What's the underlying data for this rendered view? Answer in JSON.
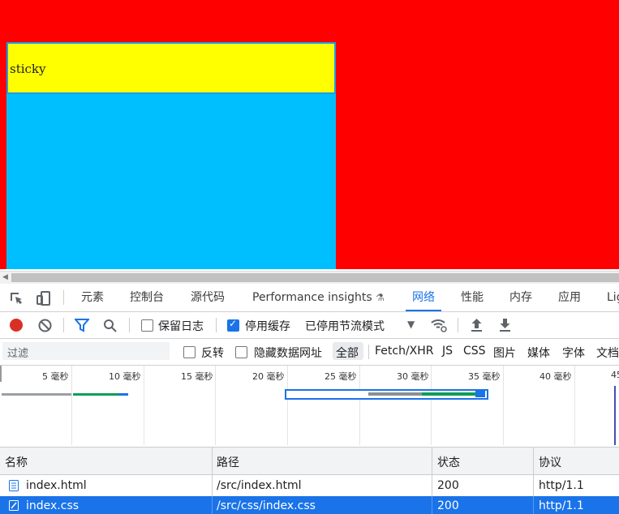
{
  "page": {
    "sticky_text": "sticky"
  },
  "devtools": {
    "tabs": [
      "元素",
      "控制台",
      "源代码",
      "Performance insights",
      "网络",
      "性能",
      "内存",
      "应用",
      "Lig"
    ],
    "active_tab": "网络",
    "toolbar": {
      "preserve_log": "保留日志",
      "preserve_log_checked": false,
      "disable_cache": "停用缓存",
      "disable_cache_checked": true,
      "throttle": "已停用节流模式"
    },
    "filter": {
      "placeholder": "过滤",
      "invert": "反转",
      "hide_data_urls": "隐藏数据网址",
      "types": [
        "全部",
        "Fetch/XHR",
        "JS",
        "CSS",
        "图片",
        "媒体",
        "字体",
        "文档"
      ],
      "active_type": "全部"
    },
    "timeline": {
      "ticks": [
        "5 毫秒",
        "10 毫秒",
        "15 毫秒",
        "20 毫秒",
        "25 毫秒",
        "30 毫秒",
        "35 毫秒",
        "40 毫秒",
        "45"
      ]
    },
    "table": {
      "columns": [
        "名称",
        "路径",
        "状态",
        "协议"
      ],
      "rows": [
        {
          "name": "index.html",
          "path": "/src/index.html",
          "status": "200",
          "protocol": "http/1.1",
          "selected": false
        },
        {
          "name": "index.css",
          "path": "/src/css/index.css",
          "status": "200",
          "protocol": "http/1.1",
          "selected": true
        }
      ]
    }
  },
  "colors": {
    "accent": "#1a73e8",
    "page_bg": "#ff0000",
    "box": "#00bfff",
    "sticky": "#ffff00"
  }
}
